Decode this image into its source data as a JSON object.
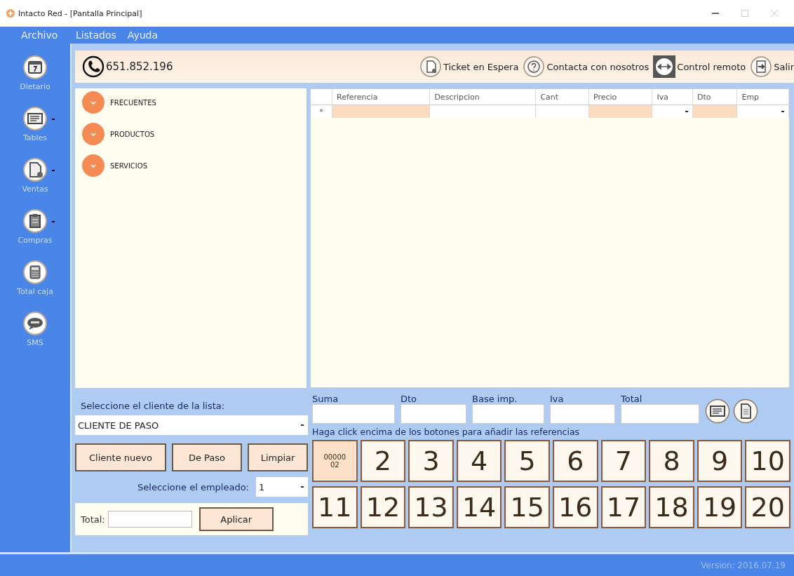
{
  "window": {
    "title": "Intacto Red - [Pantalla Principal]"
  },
  "menu": [
    "Archivo",
    "Listados",
    "Ayuda"
  ],
  "sidebar": {
    "items": [
      {
        "label": "Dietario",
        "dropdown": false
      },
      {
        "label": "Tables",
        "dropdown": true
      },
      {
        "label": "Ventas",
        "dropdown": true
      },
      {
        "label": "Compras",
        "dropdown": true
      },
      {
        "label": "Total caja",
        "dropdown": false
      },
      {
        "label": "SMS",
        "dropdown": false
      }
    ]
  },
  "header": {
    "phone": "651.852.196",
    "actions": [
      {
        "label": "Ticket en Espera"
      },
      {
        "label": "Contacta con nosotros"
      },
      {
        "label": "Control remoto"
      },
      {
        "label": "Salir"
      }
    ]
  },
  "categories": [
    {
      "label": "FRECUENTES"
    },
    {
      "label": "PRODUCTOS"
    },
    {
      "label": "SERVICIOS"
    }
  ],
  "table": {
    "new_row_marker": "*",
    "columns": [
      {
        "label": "Referencia",
        "highlighted": true,
        "dropdown": false
      },
      {
        "label": "Descripcion",
        "highlighted": false,
        "dropdown": false
      },
      {
        "label": "Cant",
        "highlighted": false,
        "dropdown": false
      },
      {
        "label": "Precio",
        "highlighted": true,
        "dropdown": false
      },
      {
        "label": "Iva",
        "highlighted": false,
        "dropdown": true
      },
      {
        "label": "Dto",
        "highlighted": true,
        "dropdown": false
      },
      {
        "label": "Emp",
        "highlighted": false,
        "dropdown": true
      }
    ]
  },
  "client": {
    "label": "Seleccione el cliente de la lista:",
    "value": "CLIENTE DE PASO",
    "buttons": [
      "Cliente nuevo",
      "De Paso",
      "Limpiar"
    ],
    "employee_label": "Seleccione el empleado:",
    "employee_value": "1",
    "total_label": "Total:",
    "apply_button": "Aplicar"
  },
  "totals": [
    {
      "label": "Suma"
    },
    {
      "label": "Dto"
    },
    {
      "label": "Base imp."
    },
    {
      "label": "Iva"
    },
    {
      "label": "Total"
    }
  ],
  "hint": "Haga click encima de los botones para añadir las referencias",
  "keys": [
    {
      "label": "0000002",
      "selected": true
    },
    {
      "label": "2",
      "selected": false
    },
    {
      "label": "3",
      "selected": false
    },
    {
      "label": "4",
      "selected": false
    },
    {
      "label": "5",
      "selected": false
    },
    {
      "label": "6",
      "selected": false
    },
    {
      "label": "7",
      "selected": false
    },
    {
      "label": "8",
      "selected": false
    },
    {
      "label": "9",
      "selected": false
    },
    {
      "label": "10",
      "selected": false
    },
    {
      "label": "11",
      "selected": false
    },
    {
      "label": "12",
      "selected": false
    },
    {
      "label": "13",
      "selected": false
    },
    {
      "label": "14",
      "selected": false
    },
    {
      "label": "15",
      "selected": false
    },
    {
      "label": "16",
      "selected": false
    },
    {
      "label": "17",
      "selected": false
    },
    {
      "label": "18",
      "selected": false
    },
    {
      "label": "19",
      "selected": false
    },
    {
      "label": "20",
      "selected": false
    }
  ],
  "status_bar": {
    "version": "Version: 2016.07.19"
  }
}
